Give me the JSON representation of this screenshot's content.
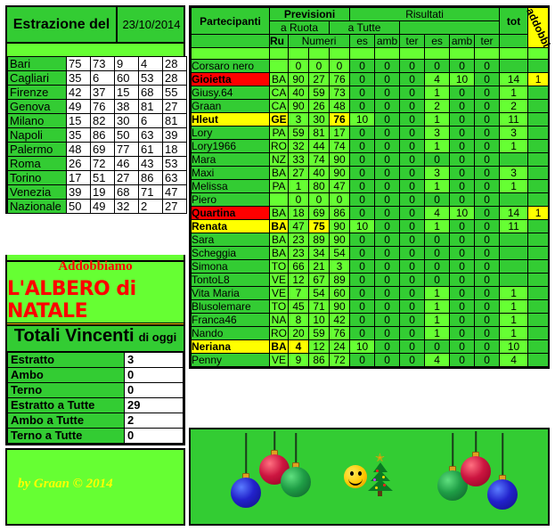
{
  "left": {
    "estrazione_label": "Estrazione del",
    "estrazione_date": "23/10/2014",
    "ruote": [
      {
        "city": "Bari",
        "numbers": [
          "75",
          "73",
          "9",
          "4",
          "28"
        ]
      },
      {
        "city": "Cagliari",
        "numbers": [
          "35",
          "6",
          "60",
          "53",
          "28"
        ]
      },
      {
        "city": "Firenze",
        "numbers": [
          "42",
          "37",
          "15",
          "68",
          "55"
        ]
      },
      {
        "city": "Genova",
        "numbers": [
          "49",
          "76",
          "38",
          "81",
          "27"
        ]
      },
      {
        "city": "Milano",
        "numbers": [
          "15",
          "82",
          "30",
          "6",
          "81"
        ]
      },
      {
        "city": "Napoli",
        "numbers": [
          "35",
          "86",
          "50",
          "63",
          "39"
        ]
      },
      {
        "city": "Palermo",
        "numbers": [
          "48",
          "69",
          "77",
          "61",
          "18"
        ]
      },
      {
        "city": "Roma",
        "numbers": [
          "26",
          "72",
          "46",
          "43",
          "53"
        ]
      },
      {
        "city": "Torino",
        "numbers": [
          "17",
          "51",
          "27",
          "86",
          "63"
        ]
      },
      {
        "city": "Venezia",
        "numbers": [
          "39",
          "19",
          "68",
          "71",
          "47"
        ]
      },
      {
        "city": "Nazionale",
        "numbers": [
          "50",
          "49",
          "32",
          "2",
          "27"
        ]
      }
    ],
    "banner": {
      "line1": "Addobbiamo",
      "line2": "L'ALBERO di NATALE"
    },
    "totali": {
      "title": "Totali Vincenti",
      "subtitle": "di oggi",
      "rows": [
        {
          "label": "Estratto",
          "value": "3"
        },
        {
          "label": "Ambo",
          "value": "0"
        },
        {
          "label": "Terno",
          "value": "0"
        },
        {
          "label": "Estratto a Tutte",
          "value": "29"
        },
        {
          "label": "Ambo a Tutte",
          "value": "2"
        },
        {
          "label": "Terno a Tutte",
          "value": "0"
        }
      ]
    },
    "signature": "by Graan © 2014"
  },
  "right": {
    "headers": {
      "partecipanti": "Partecipanti",
      "previsioni": "Previsioni",
      "risultati": "Risultati",
      "a_ruota": "a Ruota",
      "a_tutte": "a Tutte",
      "tot": "tot",
      "addobbi": "addobbi",
      "ru": "Ru",
      "numeri": "Numeri",
      "es": "es",
      "amb": "amb",
      "ter": "ter"
    },
    "rows": [
      {
        "name": "Corsaro nero",
        "style": "plain",
        "ruota": "",
        "ruota_hl": false,
        "numbers": [
          "0",
          "0",
          "0"
        ],
        "num_hl": [
          false,
          false,
          false
        ],
        "ruota_res": [
          "0",
          "0",
          "0"
        ],
        "tutte_res": [
          "0",
          "0",
          "0"
        ],
        "tot": "",
        "addobbi": ""
      },
      {
        "name": "Gioietta",
        "style": "red",
        "ruota": "BA",
        "ruota_hl": false,
        "numbers": [
          "90",
          "27",
          "76"
        ],
        "num_hl": [
          false,
          false,
          false
        ],
        "ruota_res": [
          "0",
          "0",
          "0"
        ],
        "tutte_res": [
          "4",
          "10",
          "0"
        ],
        "tot": "14",
        "addobbi": "1"
      },
      {
        "name": "Giusy.64",
        "style": "plain",
        "ruota": "CA",
        "ruota_hl": false,
        "numbers": [
          "40",
          "59",
          "73"
        ],
        "num_hl": [
          false,
          false,
          false
        ],
        "ruota_res": [
          "0",
          "0",
          "0"
        ],
        "tutte_res": [
          "1",
          "0",
          "0"
        ],
        "tot": "1",
        "addobbi": ""
      },
      {
        "name": "Graan",
        "style": "plain",
        "ruota": "CA",
        "ruota_hl": false,
        "numbers": [
          "90",
          "26",
          "48"
        ],
        "num_hl": [
          false,
          false,
          false
        ],
        "ruota_res": [
          "0",
          "0",
          "0"
        ],
        "tutte_res": [
          "2",
          "0",
          "0"
        ],
        "tot": "2",
        "addobbi": ""
      },
      {
        "name": "Hleut",
        "style": "yellow",
        "ruota": "GE",
        "ruota_hl": true,
        "numbers": [
          "3",
          "30",
          "76"
        ],
        "num_hl": [
          false,
          false,
          true
        ],
        "ruota_res": [
          "10",
          "0",
          "0"
        ],
        "tutte_res": [
          "1",
          "0",
          "0"
        ],
        "tot": "11",
        "addobbi": ""
      },
      {
        "name": "Lory",
        "style": "plain",
        "ruota": "PA",
        "ruota_hl": false,
        "numbers": [
          "59",
          "81",
          "17"
        ],
        "num_hl": [
          false,
          false,
          false
        ],
        "ruota_res": [
          "0",
          "0",
          "0"
        ],
        "tutte_res": [
          "3",
          "0",
          "0"
        ],
        "tot": "3",
        "addobbi": ""
      },
      {
        "name": "Lory1966",
        "style": "plain",
        "ruota": "RO",
        "ruota_hl": false,
        "numbers": [
          "32",
          "44",
          "74"
        ],
        "num_hl": [
          false,
          false,
          false
        ],
        "ruota_res": [
          "0",
          "0",
          "0"
        ],
        "tutte_res": [
          "1",
          "0",
          "0"
        ],
        "tot": "1",
        "addobbi": ""
      },
      {
        "name": "Mara",
        "style": "plain",
        "ruota": "NZ",
        "ruota_hl": false,
        "numbers": [
          "33",
          "74",
          "90"
        ],
        "num_hl": [
          false,
          false,
          false
        ],
        "ruota_res": [
          "0",
          "0",
          "0"
        ],
        "tutte_res": [
          "0",
          "0",
          "0"
        ],
        "tot": "",
        "addobbi": ""
      },
      {
        "name": "Maxi",
        "style": "plain",
        "ruota": "BA",
        "ruota_hl": false,
        "numbers": [
          "27",
          "40",
          "90"
        ],
        "num_hl": [
          false,
          false,
          false
        ],
        "ruota_res": [
          "0",
          "0",
          "0"
        ],
        "tutte_res": [
          "3",
          "0",
          "0"
        ],
        "tot": "3",
        "addobbi": ""
      },
      {
        "name": "Melissa",
        "style": "plain",
        "ruota": "PA",
        "ruota_hl": false,
        "numbers": [
          "1",
          "80",
          "47"
        ],
        "num_hl": [
          false,
          false,
          false
        ],
        "ruota_res": [
          "0",
          "0",
          "0"
        ],
        "tutte_res": [
          "1",
          "0",
          "0"
        ],
        "tot": "1",
        "addobbi": ""
      },
      {
        "name": "Piero",
        "style": "plain",
        "ruota": "",
        "ruota_hl": false,
        "numbers": [
          "0",
          "0",
          "0"
        ],
        "num_hl": [
          false,
          false,
          false
        ],
        "ruota_res": [
          "0",
          "0",
          "0"
        ],
        "tutte_res": [
          "0",
          "0",
          "0"
        ],
        "tot": "",
        "addobbi": ""
      },
      {
        "name": "Quartina",
        "style": "red",
        "ruota": "BA",
        "ruota_hl": false,
        "numbers": [
          "18",
          "69",
          "86"
        ],
        "num_hl": [
          false,
          false,
          false
        ],
        "ruota_res": [
          "0",
          "0",
          "0"
        ],
        "tutte_res": [
          "4",
          "10",
          "0"
        ],
        "tot": "14",
        "addobbi": "1"
      },
      {
        "name": "Renata",
        "style": "yellow",
        "ruota": "BA",
        "ruota_hl": true,
        "numbers": [
          "47",
          "75",
          "90"
        ],
        "num_hl": [
          false,
          true,
          false
        ],
        "ruota_res": [
          "10",
          "0",
          "0"
        ],
        "tutte_res": [
          "1",
          "0",
          "0"
        ],
        "tot": "11",
        "addobbi": ""
      },
      {
        "name": "Sara",
        "style": "plain",
        "ruota": "BA",
        "ruota_hl": false,
        "numbers": [
          "23",
          "89",
          "90"
        ],
        "num_hl": [
          false,
          false,
          false
        ],
        "ruota_res": [
          "0",
          "0",
          "0"
        ],
        "tutte_res": [
          "0",
          "0",
          "0"
        ],
        "tot": "",
        "addobbi": ""
      },
      {
        "name": "Scheggia",
        "style": "plain",
        "ruota": "BA",
        "ruota_hl": false,
        "numbers": [
          "23",
          "34",
          "54"
        ],
        "num_hl": [
          false,
          false,
          false
        ],
        "ruota_res": [
          "0",
          "0",
          "0"
        ],
        "tutte_res": [
          "0",
          "0",
          "0"
        ],
        "tot": "",
        "addobbi": ""
      },
      {
        "name": "Simona",
        "style": "plain",
        "ruota": "TO",
        "ruota_hl": false,
        "numbers": [
          "66",
          "21",
          "3"
        ],
        "num_hl": [
          false,
          false,
          false
        ],
        "ruota_res": [
          "0",
          "0",
          "0"
        ],
        "tutte_res": [
          "0",
          "0",
          "0"
        ],
        "tot": "",
        "addobbi": ""
      },
      {
        "name": "TontoL8",
        "style": "plain",
        "ruota": "VE",
        "ruota_hl": false,
        "numbers": [
          "12",
          "67",
          "89"
        ],
        "num_hl": [
          false,
          false,
          false
        ],
        "ruota_res": [
          "0",
          "0",
          "0"
        ],
        "tutte_res": [
          "0",
          "0",
          "0"
        ],
        "tot": "",
        "addobbi": ""
      },
      {
        "name": "Vita Maria",
        "style": "plain",
        "ruota": "VE",
        "ruota_hl": false,
        "numbers": [
          "7",
          "54",
          "60"
        ],
        "num_hl": [
          false,
          false,
          false
        ],
        "ruota_res": [
          "0",
          "0",
          "0"
        ],
        "tutte_res": [
          "1",
          "0",
          "0"
        ],
        "tot": "1",
        "addobbi": ""
      },
      {
        "name": "Blusolemare",
        "style": "plain",
        "ruota": "TO",
        "ruota_hl": false,
        "numbers": [
          "45",
          "71",
          "90"
        ],
        "num_hl": [
          false,
          false,
          false
        ],
        "ruota_res": [
          "0",
          "0",
          "0"
        ],
        "tutte_res": [
          "1",
          "0",
          "0"
        ],
        "tot": "1",
        "addobbi": ""
      },
      {
        "name": "Franca46",
        "style": "plain",
        "ruota": "NA",
        "ruota_hl": false,
        "numbers": [
          "8",
          "10",
          "42"
        ],
        "num_hl": [
          false,
          false,
          false
        ],
        "ruota_res": [
          "0",
          "0",
          "0"
        ],
        "tutte_res": [
          "1",
          "0",
          "0"
        ],
        "tot": "1",
        "addobbi": ""
      },
      {
        "name": "Nando",
        "style": "plain",
        "ruota": "RO",
        "ruota_hl": false,
        "numbers": [
          "20",
          "59",
          "76"
        ],
        "num_hl": [
          false,
          false,
          false
        ],
        "ruota_res": [
          "0",
          "0",
          "0"
        ],
        "tutte_res": [
          "1",
          "0",
          "0"
        ],
        "tot": "1",
        "addobbi": ""
      },
      {
        "name": "Neriana",
        "style": "yellow",
        "ruota": "BA",
        "ruota_hl": true,
        "numbers": [
          "4",
          "12",
          "24"
        ],
        "num_hl": [
          true,
          false,
          false
        ],
        "ruota_res": [
          "10",
          "0",
          "0"
        ],
        "tutte_res": [
          "0",
          "0",
          "0"
        ],
        "tot": "10",
        "addobbi": ""
      },
      {
        "name": "Penny",
        "style": "plain",
        "ruota": "VE",
        "ruota_hl": false,
        "numbers": [
          "9",
          "86",
          "72"
        ],
        "num_hl": [
          false,
          false,
          false
        ],
        "ruota_res": [
          "0",
          "0",
          "0"
        ],
        "tutte_res": [
          "4",
          "0",
          "0"
        ],
        "tot": "4",
        "addobbi": ""
      }
    ]
  },
  "colors": {
    "green_mid": "#33cc33",
    "green_light": "#66ff33",
    "red": "#ff0000",
    "yellow": "#ffff00",
    "white": "#ffffff",
    "black": "#000000"
  },
  "decoration": {
    "items": [
      "bauble-blue",
      "bauble-red",
      "bauble-green",
      "smiley-face",
      "christmas-tree",
      "bauble-green",
      "bauble-red",
      "bauble-blue"
    ]
  }
}
